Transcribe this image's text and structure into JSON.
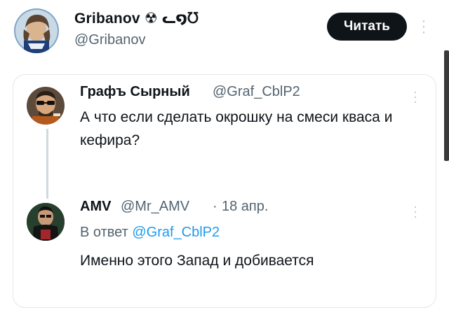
{
  "header": {
    "display_name": "Gribanov ☢ ᓚ໑ᘮ",
    "handle": "@Gribanov",
    "follow_label": "Читать"
  },
  "quoted_thread": {
    "tweet1": {
      "author": "Графъ Сырный",
      "handle": "@Graf_CblP2",
      "text": "А что если сделать окрошку на смеси кваса и кефира?"
    },
    "tweet2": {
      "author": "AMV",
      "handle": "@Mr_AMV",
      "separator": "·",
      "date": "18 апр.",
      "reply_prefix": "В ответ",
      "reply_mention": "@Graf_CblP2",
      "text": "Именно этого Запад и добивается"
    }
  },
  "icons": {
    "more": "more-vertical-icon"
  },
  "colors": {
    "follow_bg": "#0f1419",
    "mention": "#1d9bf0",
    "secondary_text": "#536471"
  }
}
